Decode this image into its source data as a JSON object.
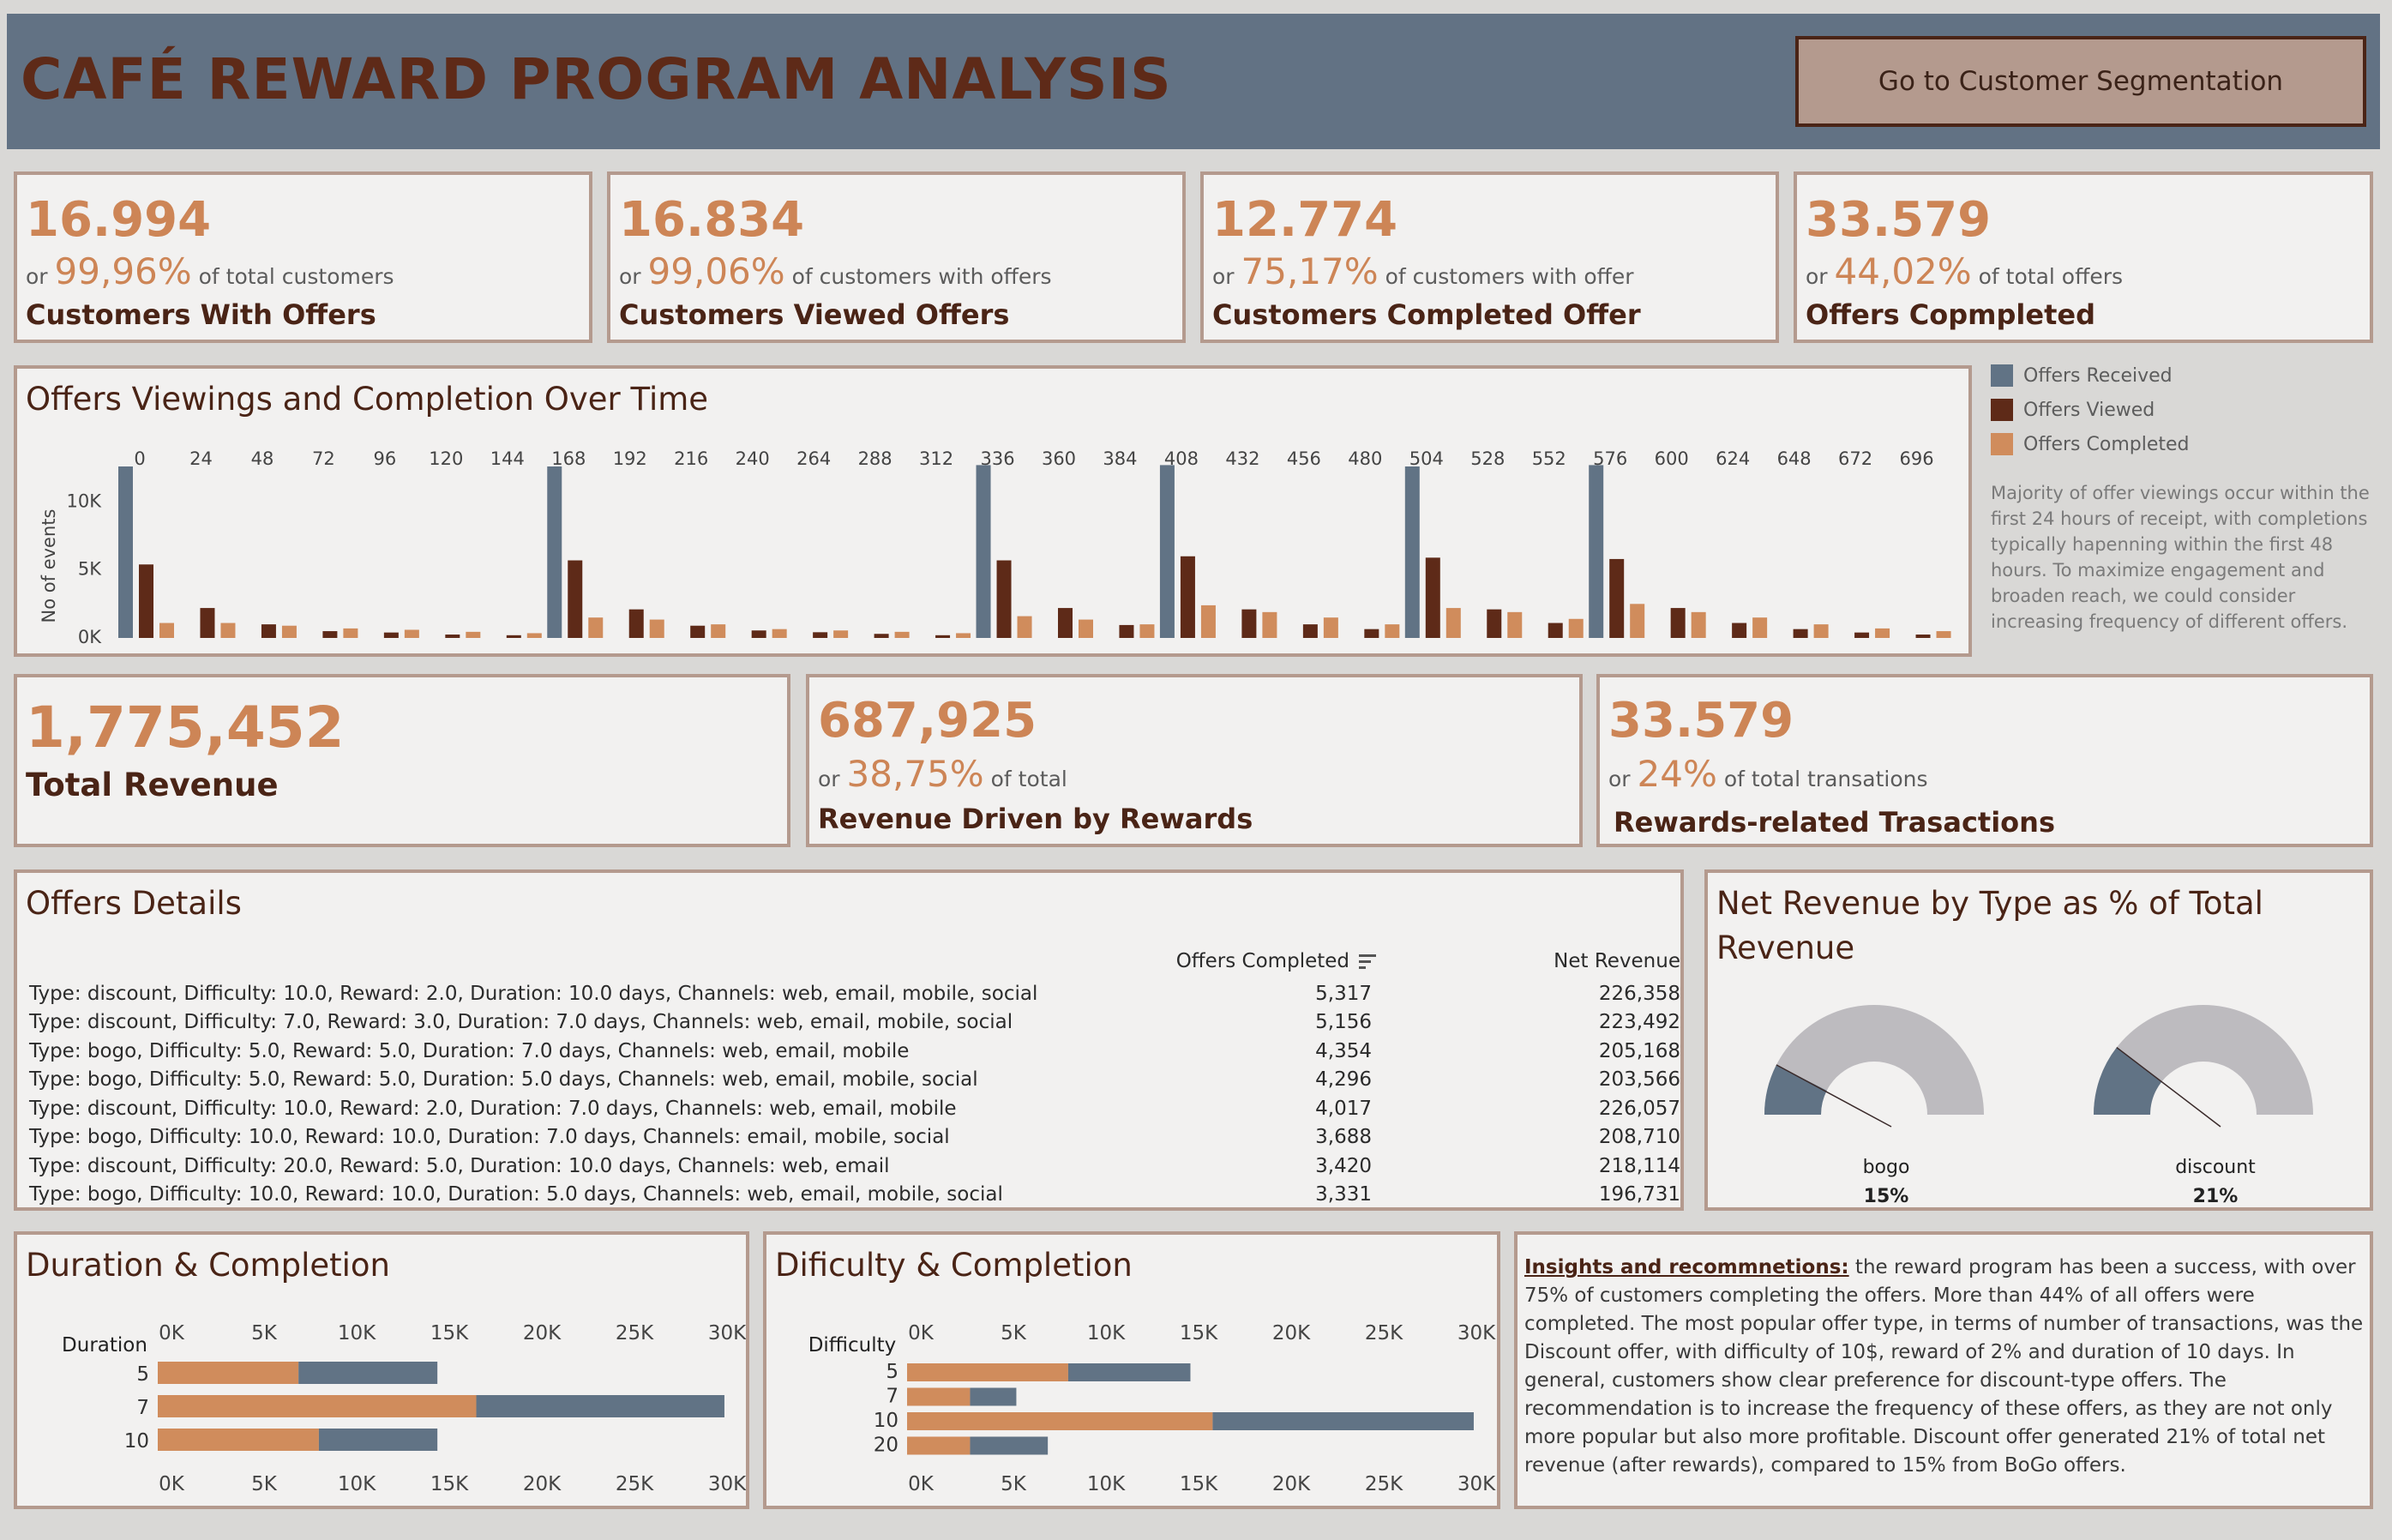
{
  "header": {
    "title": "CAFÉ REWARD PROGRAM ANALYSIS",
    "nav_button": "Go to Customer Segmentation"
  },
  "kpis_top": [
    {
      "value": "16.994",
      "prefix": "or",
      "pct": "99,96%",
      "suffix": "of total customers",
      "label": "Customers With Offers"
    },
    {
      "value": "16.834",
      "prefix": "or",
      "pct": "99,06%",
      "suffix": "of  customers with offers",
      "label": "Customers Viewed Offers"
    },
    {
      "value": "12.774",
      "prefix": "or",
      "pct": "75,17%",
      "suffix": "of customers with offer",
      "label": "Customers Completed Offer"
    },
    {
      "value": "33.579",
      "prefix": "or",
      "pct": "44,02%",
      "suffix": "of total offers",
      "label": "Offers Copmpleted"
    }
  ],
  "timeline": {
    "title": "Offers Viewings and Completion Over Time",
    "legend": [
      "Offers Received",
      "Offers Viewed",
      "Offers Completed"
    ],
    "note": "Majority of offer viewings occur within the first 24 hours of receipt, with completions typically hapenning within the first 48 hours. To maximize engagement and broaden reach, we could consider increasing frequency of different offers."
  },
  "kpis_mid": [
    {
      "value": "1,775,452",
      "label": "Total Revenue"
    },
    {
      "value": "687,925",
      "prefix": "or",
      "pct": "38,75%",
      "suffix": "of total",
      "label": "Revenue Driven by Rewards"
    },
    {
      "value": "33.579",
      "prefix": "or",
      "pct": "24%",
      "suffix": "of total transations",
      "label": "Rewards-related Trasactions"
    }
  ],
  "offers_details": {
    "title": "Offers Details",
    "col_completed": "Offers Completed",
    "col_revenue": "Net Revenue",
    "rows": [
      {
        "desc": "Type: discount, Difficulty: 10.0, Reward: 2.0, Duration: 10.0 days, Channels: web, email, mobile, social",
        "completed": "5,317",
        "revenue": "226,358"
      },
      {
        "desc": "Type: discount, Difficulty: 7.0, Reward: 3.0, Duration: 7.0 days, Channels: web, email, mobile, social",
        "completed": "5,156",
        "revenue": "223,492"
      },
      {
        "desc": "Type: bogo, Difficulty: 5.0, Reward: 5.0, Duration: 7.0 days, Channels: web, email, mobile",
        "completed": "4,354",
        "revenue": "205,168"
      },
      {
        "desc": "Type: bogo, Difficulty: 5.0, Reward: 5.0, Duration: 5.0 days, Channels: web, email, mobile, social",
        "completed": "4,296",
        "revenue": "203,566"
      },
      {
        "desc": "Type: discount, Difficulty: 10.0, Reward: 2.0, Duration: 7.0 days, Channels: web, email, mobile",
        "completed": "4,017",
        "revenue": "226,057"
      },
      {
        "desc": "Type: bogo, Difficulty: 10.0, Reward: 10.0, Duration: 7.0 days, Channels: email, mobile, social",
        "completed": "3,688",
        "revenue": "208,710"
      },
      {
        "desc": "Type: discount, Difficulty: 20.0, Reward: 5.0, Duration: 10.0 days, Channels: web, email",
        "completed": "3,420",
        "revenue": "218,114"
      },
      {
        "desc": "Type: bogo, Difficulty: 10.0, Reward: 10.0, Duration: 5.0 days, Channels: web, email, mobile, social",
        "completed": "3,331",
        "revenue": "196,731"
      }
    ]
  },
  "gauges_title": "Net Revenue by Type as % of Total Revenue",
  "durations_title": "Duration & Completion",
  "difficulty_title": "Dificulty & Completion",
  "insights": {
    "heading": "Insights and recommnetions:",
    "text": " the reward program has been a success, with over 75% of customers completing the offers. More than 44% of all offers were completed. The most popular offer type, in terms of number of transactions, was the Discount offer, with difficulty of 10$, reward of 2% and duration of 10 days. In general, customers show clear preference for discount-type offers. The recommendation is to increase the frequency of these offers, as they are not only more popular but also more profitable. Discount offer generated  21% of total net revenue (after rewards), compared to 15% from BoGo offers."
  },
  "colors": {
    "received": "#617385",
    "viewed": "#5e2a18",
    "completed": "#d08c5c",
    "gauge_bg": "#bdbbbf"
  },
  "chart_data": [
    {
      "type": "bar",
      "title": "Offers Viewings and Completion Over Time",
      "xlabel": "",
      "ylabel": "No of events",
      "yticks": [
        "0K",
        "5K",
        "10K"
      ],
      "ylim": [
        0,
        12600
      ],
      "categories": [
        0,
        24,
        48,
        72,
        96,
        120,
        144,
        168,
        192,
        216,
        240,
        264,
        288,
        312,
        336,
        360,
        384,
        408,
        432,
        456,
        480,
        504,
        528,
        552,
        576,
        600,
        624,
        648,
        672,
        696
      ],
      "series": [
        {
          "name": "Offers Received",
          "values": [
            12600,
            0,
            0,
            0,
            0,
            0,
            0,
            12600,
            0,
            0,
            0,
            0,
            0,
            0,
            12700,
            0,
            0,
            12700,
            0,
            0,
            0,
            12600,
            0,
            0,
            12700,
            0,
            0,
            0,
            0,
            0
          ]
        },
        {
          "name": "Offers Viewed",
          "values": [
            5400,
            2200,
            1000,
            500,
            400,
            250,
            200,
            5700,
            2100,
            900,
            550,
            420,
            300,
            200,
            5700,
            2200,
            950,
            6000,
            2100,
            1000,
            650,
            5900,
            2100,
            1100,
            5800,
            2200,
            1100,
            650,
            400,
            250
          ]
        },
        {
          "name": "Offers Completed",
          "values": [
            1100,
            1100,
            900,
            700,
            600,
            450,
            350,
            1500,
            1350,
            1000,
            650,
            550,
            450,
            350,
            1600,
            1350,
            1000,
            2400,
            1900,
            1500,
            1000,
            2200,
            1900,
            1400,
            2500,
            1900,
            1500,
            1000,
            700,
            500
          ]
        }
      ],
      "legend": "right"
    },
    {
      "type": "gauge",
      "title": "Net Revenue by Type as % of Total Revenue",
      "categories": [
        "bogo",
        "discount"
      ],
      "values": [
        15,
        21
      ],
      "labels": [
        "15%",
        "21%"
      ]
    },
    {
      "type": "bar",
      "orientation": "horizontal",
      "title": "Duration & Completion",
      "ylabel": "Duration",
      "categories": [
        "5",
        "7",
        "10"
      ],
      "xticks": [
        "0K",
        "5K",
        "10K",
        "15K",
        "20K",
        "25K",
        "30K"
      ],
      "xlim": [
        0,
        30000
      ],
      "series": [
        {
          "name": "Offers Completed",
          "values": [
            7600,
            17200,
            8700
          ]
        },
        {
          "name": "Offers Received",
          "values": [
            7500,
            13400,
            6400
          ]
        }
      ]
    },
    {
      "type": "bar",
      "orientation": "horizontal",
      "title": "Dificulty & Completion",
      "ylabel": "Difficulty",
      "categories": [
        "5",
        "7",
        "10",
        "20"
      ],
      "xticks": [
        "0K",
        "5K",
        "10K",
        "15K",
        "20K",
        "25K",
        "30K"
      ],
      "xlim": [
        0,
        30000
      ],
      "series": [
        {
          "name": "Offers Completed",
          "values": [
            8700,
            3400,
            16500,
            3400
          ]
        },
        {
          "name": "Offers Received",
          "values": [
            6600,
            2500,
            14100,
            4200
          ]
        }
      ]
    }
  ]
}
